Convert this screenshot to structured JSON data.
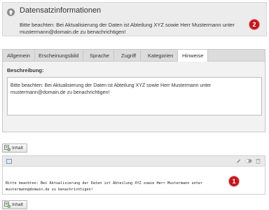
{
  "info": {
    "title": "Datensatzinformationen",
    "text": "Bitte beachten: Bei Aktualisierung der Daten ist Abteilung XYZ sowie Herr Mustermann unter mustermann@domain.de zu benachrichtigen!",
    "icon": "lightbulb-icon"
  },
  "badges": {
    "first": "1",
    "second": "2",
    "color": "#c3171e"
  },
  "tabs": [
    {
      "label": "Allgemein"
    },
    {
      "label": "Erscheinungsbild"
    },
    {
      "label": "Sprache"
    },
    {
      "label": "Zugriff"
    },
    {
      "label": "Kategorien"
    },
    {
      "label": "Hinweise"
    }
  ],
  "active_tab": "Hinweise",
  "form": {
    "description_label": "Beschreibung:",
    "description_value": "Bitte beachten: Bei Aktualisierung der Daten ist Abteilung XYZ sowie Herr Mustermann unter mustermann@domain.de zu benachrichtigen!"
  },
  "content_button": {
    "label": "Inhalt",
    "icon": "add-content-icon"
  },
  "preview": {
    "text": "Bitte beachten: Bei Aktualisierung der Daten ist Abteilung XYZ sowie Herr Mustermann unter mustermann@domain.de zu benachrichtigen!",
    "type_icon": "text-element-icon",
    "actions": [
      "edit-icon",
      "toggle-icon",
      "delete-icon"
    ]
  }
}
